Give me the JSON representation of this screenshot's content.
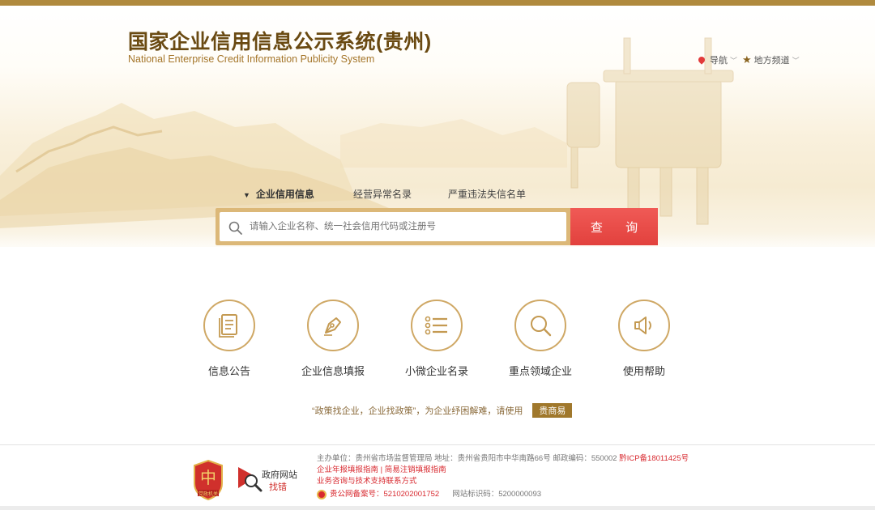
{
  "header": {
    "title_cn": "国家企业信用信息公示系统(贵州)",
    "title_en": "National Enterprise Credit Information Publicity System",
    "nav_label": "导航",
    "local_channel_label": "地方频道"
  },
  "search": {
    "tabs": [
      {
        "label": "企业信用信息",
        "active": true
      },
      {
        "label": "经营异常名录",
        "active": false
      },
      {
        "label": "严重违法失信名单",
        "active": false
      }
    ],
    "placeholder": "请输入企业名称、统一社会信用代码或注册号",
    "button_label": "查 询"
  },
  "features": [
    {
      "label": "信息公告",
      "icon": "document-icon"
    },
    {
      "label": "企业信息填报",
      "icon": "pen-nib-icon"
    },
    {
      "label": "小微企业名录",
      "icon": "list-icon"
    },
    {
      "label": "重点领域企业",
      "icon": "magnifier-icon"
    },
    {
      "label": "使用帮助",
      "icon": "speaker-icon"
    }
  ],
  "slogan": {
    "text": "“政策找企业，企业找政策”，为企业纾困解难，请使用",
    "badge": "贵商易"
  },
  "footer": {
    "emblem_label": "党政机关",
    "gov_site_label": "政府网站",
    "gov_find_error": "找错",
    "sponsor": "主办单位：贵州省市场监督管理局  地址：贵州省贵阳市中华南路66号  邮政编码：550002",
    "icp": "黔ICP备18011425号",
    "link_annual": "企业年报填报指南",
    "link_divider": "|",
    "link_simple": "简易注销填报指南",
    "support": "业务咨询与技术支持联系方式",
    "police_record": "贵公网备案号：5210202001752",
    "site_id": "网站标识码：5200000093"
  },
  "colors": {
    "gold": "#b08a3e",
    "title_brown": "#6a4a12",
    "search_red": "#e2413d",
    "footer_red": "#d8292f"
  }
}
